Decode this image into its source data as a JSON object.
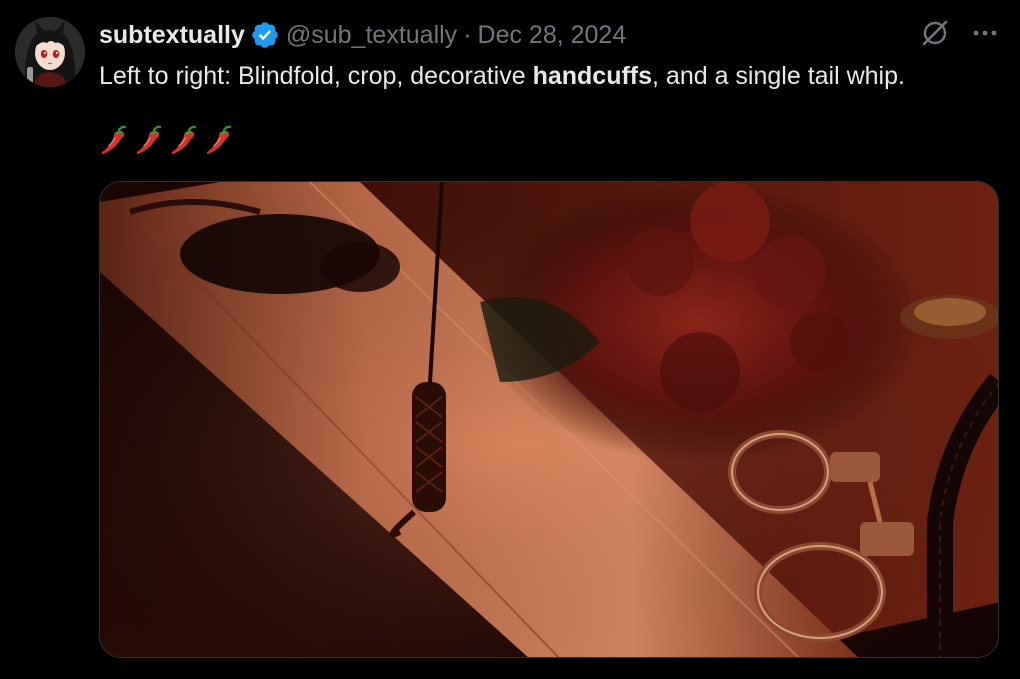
{
  "author": {
    "display_name": "subtextually",
    "handle": "@sub_textually",
    "separator": "·",
    "date": "Dec 28, 2024",
    "verified": true,
    "verified_color": "#1d9bf0"
  },
  "tweet": {
    "text_before": "Left to right: Blindfold, crop, decorative ",
    "text_bold": "handcuffs",
    "text_after": ", and a single tail whip.",
    "emoji": [
      "hot-pepper",
      "hot-pepper",
      "hot-pepper",
      "hot-pepper"
    ]
  },
  "actions": {
    "icons": [
      "grok-icon",
      "more-icon"
    ]
  },
  "media": {
    "type": "photo",
    "icon": "photo"
  },
  "colors": {
    "background": "#000000",
    "text_primary": "#e7e9ea",
    "text_secondary": "#71767b",
    "verified": "#1d9bf0",
    "pepper": "#d6322c"
  }
}
